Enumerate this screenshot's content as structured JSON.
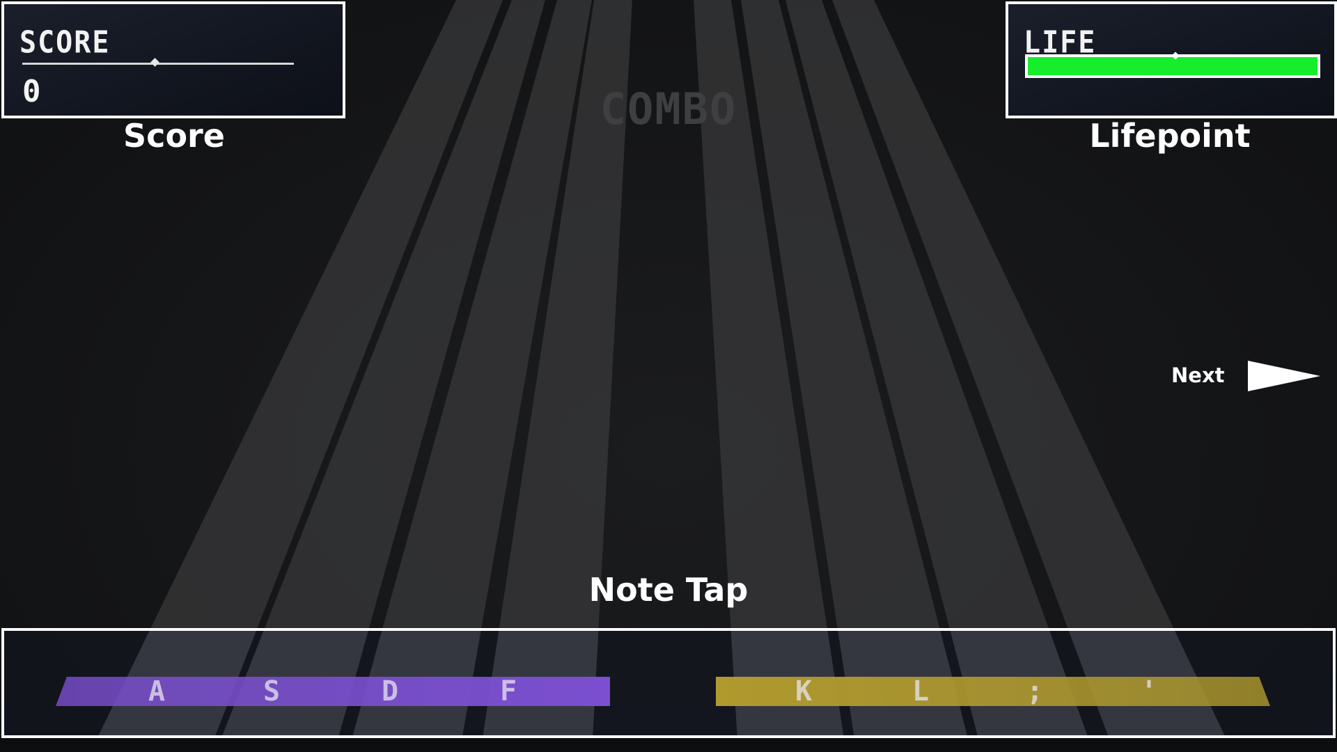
{
  "hud": {
    "score": {
      "title": "SCORE",
      "value": "0",
      "caption": "Score"
    },
    "life": {
      "title": "LIFE",
      "caption": "Lifepoint",
      "level": 1.0,
      "bar_color": "#16ee2c"
    },
    "combo_label": "COMBO"
  },
  "navigation": {
    "next_label": "Next",
    "next_icon": "play-arrow-icon"
  },
  "note_tap": {
    "caption": "Note Tap",
    "left_keys": [
      "A",
      "S",
      "D",
      "F"
    ],
    "right_keys": [
      "K",
      "L",
      ";",
      "'"
    ],
    "left_color": "#7b4fd0",
    "right_color": "#b09a2e"
  },
  "theme": {
    "background": "#131416",
    "lane_color": "#3a3a3c",
    "border_color": "#ffffff"
  }
}
